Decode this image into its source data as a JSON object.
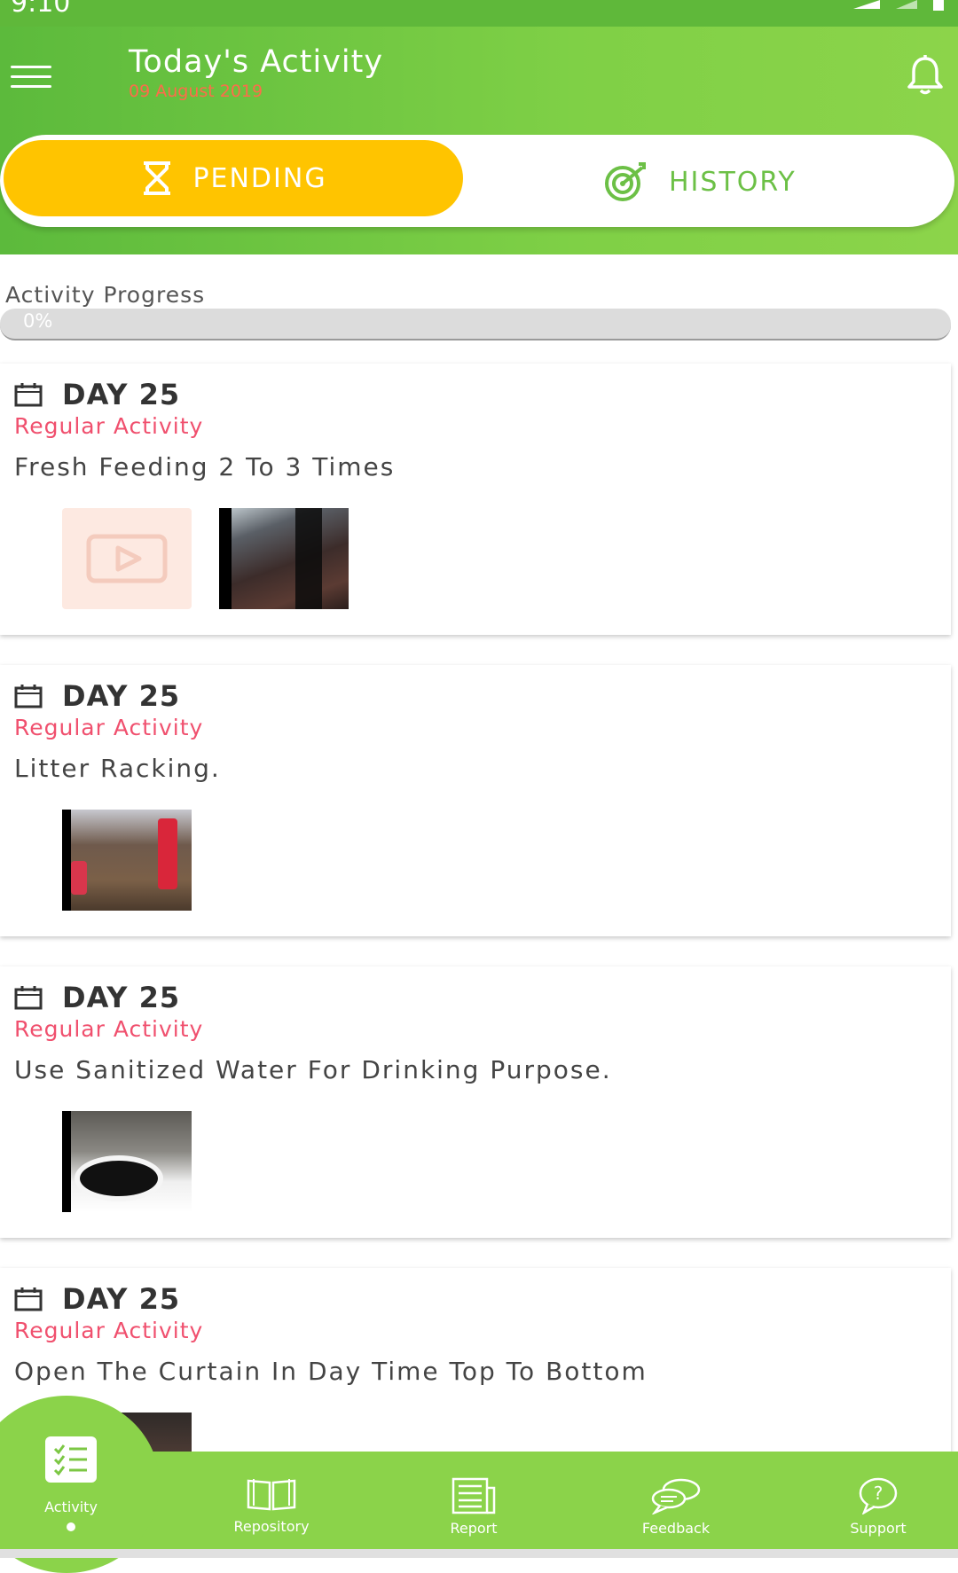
{
  "status_bar": {
    "time": "9:10"
  },
  "header": {
    "title": "Today's Activity",
    "date": "09 August 2019"
  },
  "tabs": [
    {
      "label": "PENDING",
      "icon": "hourglass-icon",
      "active": true
    },
    {
      "label": "HISTORY",
      "icon": "target-icon",
      "active": false
    }
  ],
  "progress": {
    "label": "Activity Progress",
    "value_text": "0%",
    "value": 0
  },
  "activities": [
    {
      "day": "DAY 25",
      "type": "Regular Activity",
      "description": "Fresh Feeding  2 To 3 Times"
    },
    {
      "day": "DAY 25",
      "type": "Regular Activity",
      "description": "Litter Racking."
    },
    {
      "day": "DAY 25",
      "type": "Regular Activity",
      "description": "Use Sanitized Water For Drinking Purpose."
    },
    {
      "day": "DAY 25",
      "type": "Regular Activity",
      "description": "Open The Curtain In Day Time Top To Bottom"
    }
  ],
  "bottom_nav": [
    {
      "label": "Activity",
      "icon": "checklist-icon",
      "active": true
    },
    {
      "label": "Repository",
      "icon": "book-icon"
    },
    {
      "label": "Report",
      "icon": "report-icon"
    },
    {
      "label": "Feedback",
      "icon": "chat-icon"
    },
    {
      "label": "Support",
      "icon": "help-icon"
    }
  ],
  "colors": {
    "header_green": "#6cc440",
    "pending_yellow": "#ffc400",
    "type_red": "#f0506e",
    "nav_green": "#8bd34a"
  }
}
